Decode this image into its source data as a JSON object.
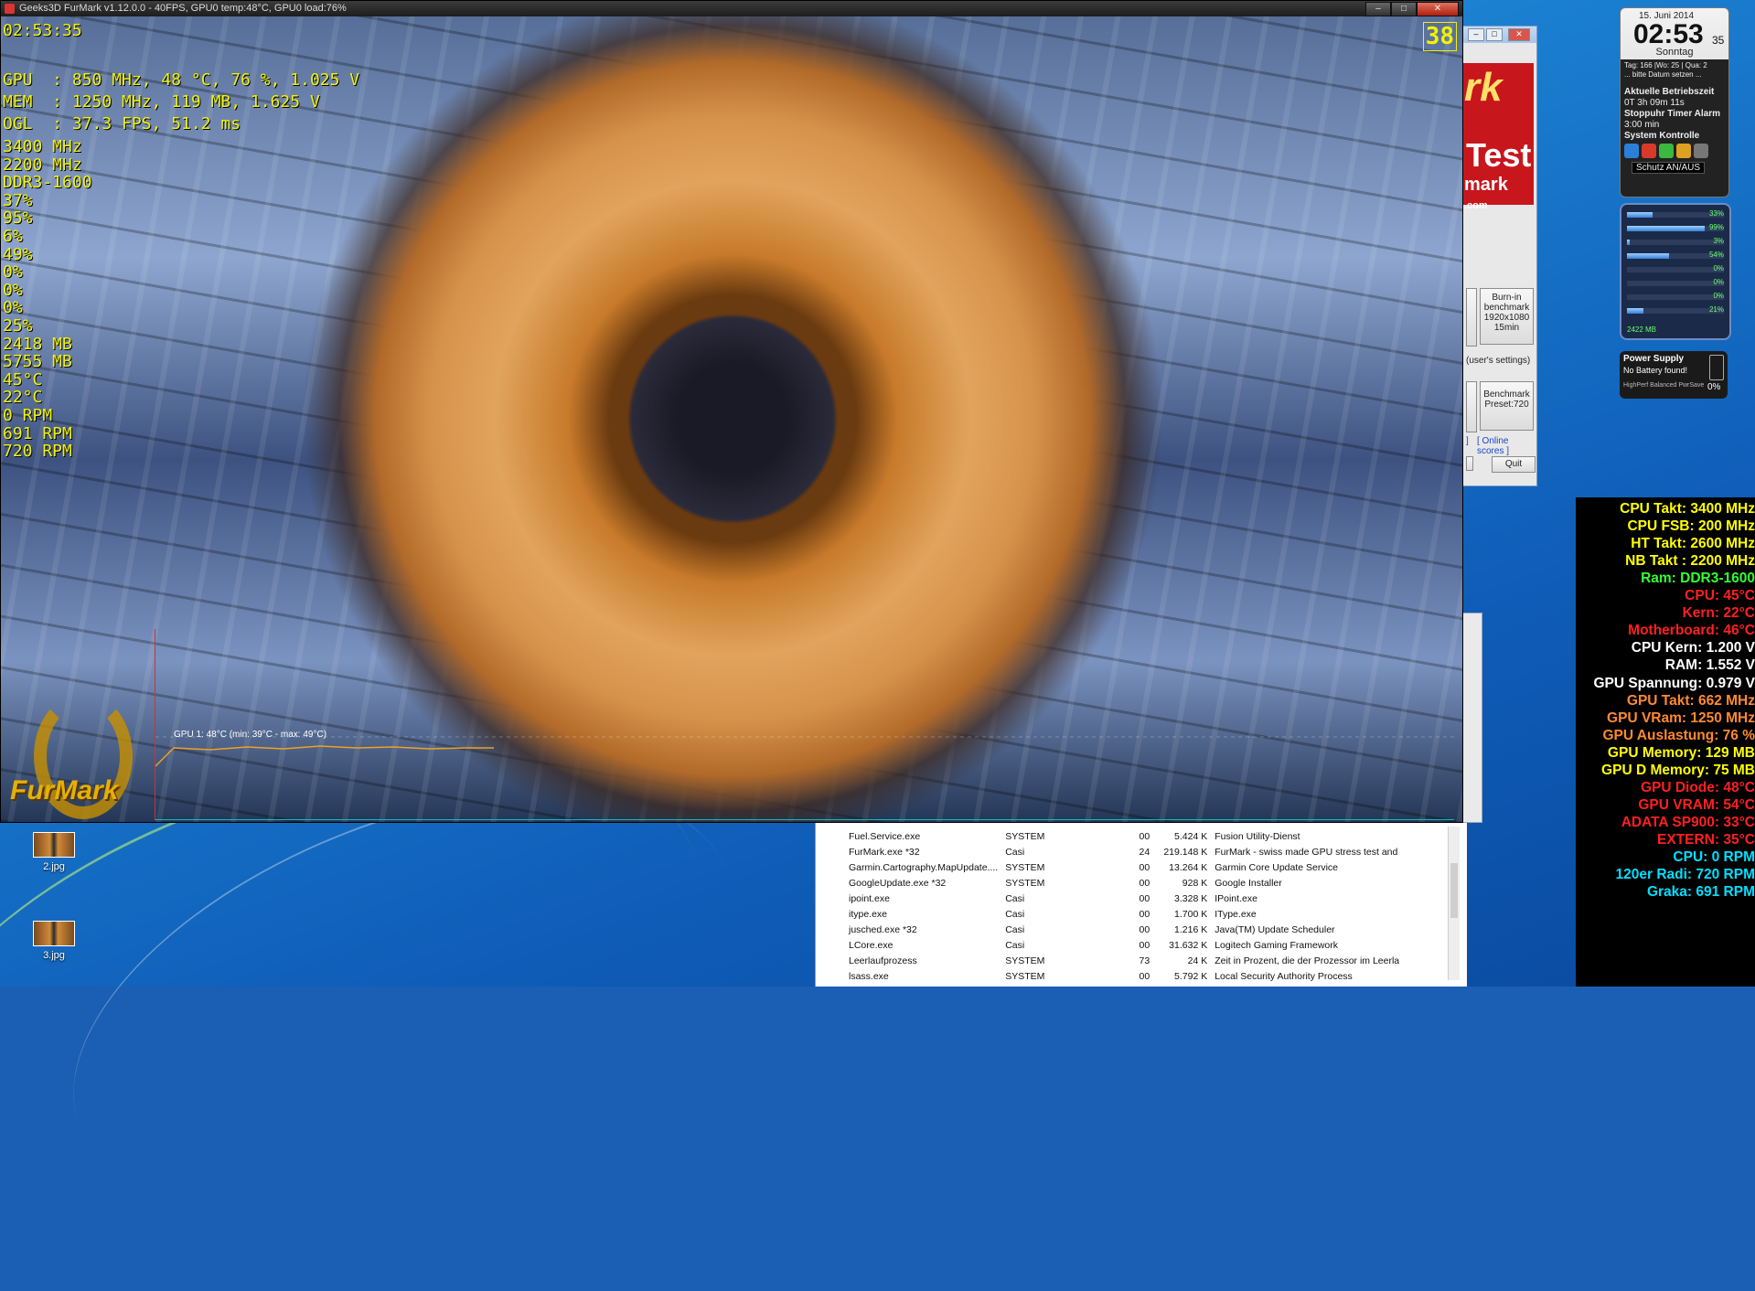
{
  "furmark": {
    "title": "Geeks3D FurMark v1.12.0.0 - 40FPS, GPU0 temp:48°C, GPU0 load:76%",
    "fps_badge": "38",
    "osd": {
      "clock": "02:53:35",
      "gpu": "GPU  : 850 MHz, 48 °C, 76 %, 1.025 V",
      "mem": "MEM  : 1250 MHz, 119 MB, 1.625 V",
      "ogl": "OGL  : 37.3 FPS, 51.2 ms",
      "stats": [
        "3400 MHz",
        "2200 MHz",
        "DDR3-1600",
        "37%",
        "95%",
        "6%",
        "49%",
        "0%",
        "0%",
        "0%",
        "25%",
        "2418 MB",
        "5755 MB",
        "45°C",
        "22°C",
        "0 RPM",
        "691 RPM",
        "720 RPM"
      ]
    },
    "graph_label": "GPU 1: 48°C (min: 39°C - max: 49°C)",
    "logo_text": "FurMark"
  },
  "launcher": {
    "banner": [
      "rk",
      "Test",
      "mark",
      ".com"
    ],
    "burnin_btn": "Burn-in benchmark 1920x1080 15min",
    "settings_btn": "(user's settings)",
    "benchmark_btn": "Benchmark Preset:720",
    "online_link": "[ Online scores ]",
    "bracket": "]",
    "quit_btn": "Quit"
  },
  "clock_gadget": {
    "date": "15. Juni 2014",
    "time": "02:53",
    "seconds": "35",
    "day": "Sonntag",
    "info1": "Tag: 166 |Wo: 25 | Qua: 2",
    "info2": "... bitte Datum setzen ...",
    "uptime_label": "Aktuelle Betriebszeit",
    "uptime": "0T 3h 09m 11s",
    "timer_label": "Stoppuhr Timer Alarm",
    "timer": "3:00 min",
    "system_label": "System Kontrolle",
    "protect": "Schutz AN/AUS"
  },
  "meter_gadget": {
    "values": [
      "33%",
      "99%",
      "3%",
      "54%",
      "0%",
      "0%",
      "0%",
      "21%"
    ],
    "fills": [
      0.33,
      0.99,
      0.03,
      0.54,
      0,
      0,
      0,
      0.21
    ],
    "memory": "2422 MB"
  },
  "power_gadget": {
    "title": "Power Supply",
    "status": "No Battery found!",
    "plans": "HighPerf  Balanced  PwrSave",
    "percent": "0%"
  },
  "sensors": [
    {
      "text": "CPU Takt: 3400 MHz",
      "color": "#ffff00"
    },
    {
      "text": "CPU FSB: 200 MHz",
      "color": "#ffff00"
    },
    {
      "text": "HT Takt: 2600 MHz",
      "color": "#ffff00"
    },
    {
      "text": "NB Takt : 2200 MHz",
      "color": "#ffff00"
    },
    {
      "text": "Ram: DDR3-1600",
      "color": "#33ff33"
    },
    {
      "text": "CPU: 45°C",
      "color": "#ff2020"
    },
    {
      "text": "Kern: 22°C",
      "color": "#ff2020"
    },
    {
      "text": "Motherboard: 46°C",
      "color": "#ff2020"
    },
    {
      "text": "CPU Kern: 1.200 V",
      "color": "#ffffff"
    },
    {
      "text": "RAM: 1.552 V",
      "color": "#ffffff"
    },
    {
      "text": "GPU Spannung: 0.979 V",
      "color": "#ffffff"
    },
    {
      "text": "GPU Takt: 662 MHz",
      "color": "#ff8a30"
    },
    {
      "text": "GPU VRam: 1250 MHz",
      "color": "#ff8a30"
    },
    {
      "text": "GPU Auslastung: 76 %",
      "color": "#ff8a30"
    },
    {
      "text": "GPU Memory: 129 MB",
      "color": "#ffff00"
    },
    {
      "text": "GPU D Memory: 75 MB",
      "color": "#ffff00"
    },
    {
      "text": "GPU Diode: 48°C",
      "color": "#ff2020"
    },
    {
      "text": "GPU VRAM: 54°C",
      "color": "#ff2020"
    },
    {
      "text": "ADATA SP900: 33°C",
      "color": "#ff2020"
    },
    {
      "text": "EXTERN: 35°C",
      "color": "#ff2020"
    },
    {
      "text": "CPU: 0 RPM",
      "color": "#00e0ff"
    },
    {
      "text": "120er Radi: 720 RPM",
      "color": "#00e0ff"
    },
    {
      "text": "Graka: 691 RPM",
      "color": "#00e0ff"
    }
  ],
  "desktop_icons": [
    {
      "label": "2.jpg"
    },
    {
      "label": "3.jpg"
    }
  ],
  "processes": [
    [
      "Fuel.Service.exe",
      "SYSTEM",
      "00",
      "5.424 K",
      "Fusion Utility-Dienst"
    ],
    [
      "FurMark.exe *32",
      "Casi",
      "24",
      "219.148 K",
      "FurMark - swiss made GPU stress test and"
    ],
    [
      "Garmin.Cartography.MapUpdate....",
      "SYSTEM",
      "00",
      "13.264 K",
      "Garmin Core Update Service"
    ],
    [
      "GoogleUpdate.exe *32",
      "SYSTEM",
      "00",
      "928 K",
      "Google Installer"
    ],
    [
      "ipoint.exe",
      "Casi",
      "00",
      "3.328 K",
      "IPoint.exe"
    ],
    [
      "itype.exe",
      "Casi",
      "00",
      "1.700 K",
      "IType.exe"
    ],
    [
      "jusched.exe *32",
      "Casi",
      "00",
      "1.216 K",
      "Java(TM) Update Scheduler"
    ],
    [
      "LCore.exe",
      "Casi",
      "00",
      "31.632 K",
      "Logitech Gaming Framework"
    ],
    [
      "Leerlaufprozess",
      "SYSTEM",
      "73",
      "24 K",
      "Zeit in Prozent, die der Prozessor im Leerla"
    ],
    [
      "lsass.exe",
      "SYSTEM",
      "00",
      "5.792 K",
      "Local Security Authority Process"
    ]
  ]
}
